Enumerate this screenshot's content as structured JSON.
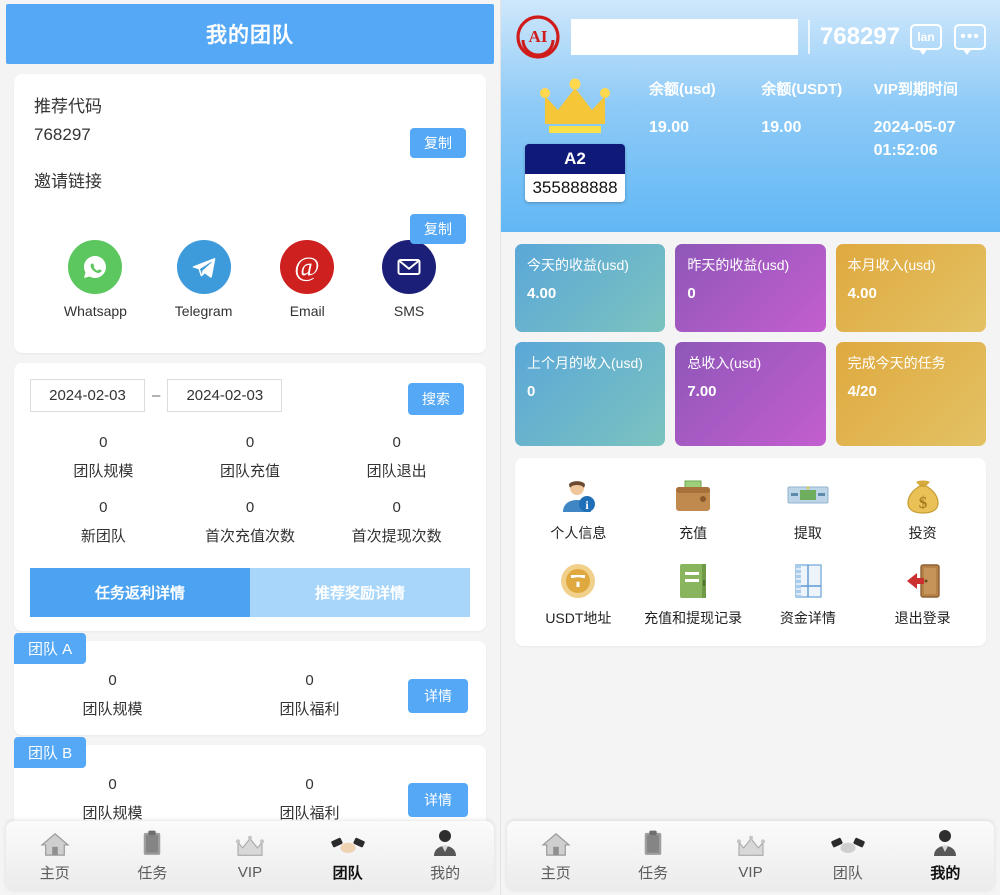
{
  "left": {
    "header": {
      "title": "我的团队"
    },
    "referral": {
      "code_label": "推荐代码",
      "code_value": "768297",
      "link_label": "邀请链接",
      "link_value": "",
      "copy_label_1": "复制",
      "copy_label_2": "复制"
    },
    "share": [
      {
        "name": "whatsapp-icon",
        "label": "Whatsapp"
      },
      {
        "name": "telegram-icon",
        "label": "Telegram"
      },
      {
        "name": "email-icon",
        "label": "Email"
      },
      {
        "name": "sms-icon",
        "label": "SMS"
      }
    ],
    "search": {
      "date_from": "2024-02-03",
      "date_to": "2024-02-03",
      "separator": "–",
      "button_label": "搜索"
    },
    "stats_row1": [
      {
        "value": "0",
        "label": "团队规模"
      },
      {
        "value": "0",
        "label": "团队充值"
      },
      {
        "value": "0",
        "label": "团队退出"
      }
    ],
    "stats_row2": [
      {
        "value": "0",
        "label": "新团队"
      },
      {
        "value": "0",
        "label": "首次充值次数"
      },
      {
        "value": "0",
        "label": "首次提现次数"
      }
    ],
    "tabs": [
      {
        "label": "任务返利详情",
        "active": true
      },
      {
        "label": "推荐奖励详情",
        "active": false
      }
    ],
    "teams": [
      {
        "tag": "团队 A",
        "stats": [
          {
            "value": "0",
            "label": "团队规模"
          },
          {
            "value": "0",
            "label": "团队福利"
          }
        ],
        "detail_label": "详情"
      },
      {
        "tag": "团队 B",
        "stats": [
          {
            "value": "0",
            "label": "团队规模"
          },
          {
            "value": "0",
            "label": "团队福利"
          }
        ],
        "detail_label": "详情"
      }
    ]
  },
  "right": {
    "header": {
      "logo_text": "AI",
      "search_value": "",
      "search_placeholder": "",
      "uid": "768297",
      "lang_icon_text": "lan",
      "chat_icon_text": "•••"
    },
    "hero": {
      "vip_level": "A2",
      "vip_number": "355888888",
      "balances": [
        {
          "label": "余额(usd)",
          "value": "19.00"
        },
        {
          "label": "余额(USDT)",
          "value": "19.00"
        },
        {
          "label": "VIP到期时间",
          "value": "2024-05-07 01:52:06"
        }
      ]
    },
    "stat_cards": [
      {
        "label": "今天的收益(usd)",
        "value": "4.00",
        "color": "#5aa7d8"
      },
      {
        "label": "昨天的收益(usd)",
        "value": "0",
        "color": "#8e57b8"
      },
      {
        "label": "本月收入(usd)",
        "value": "4.00",
        "color": "#dfa93f"
      },
      {
        "label": "上个月的收入(usd)",
        "value": "0",
        "color": "#5aa7d8"
      },
      {
        "label": "总收入(usd)",
        "value": "7.00",
        "color": "#8e57b8"
      },
      {
        "label": "完成今天的任务",
        "value": "4/20",
        "color": "#dfa93f"
      }
    ],
    "menu_row1": [
      {
        "icon": "person-info-icon",
        "label": "个人信息"
      },
      {
        "icon": "wallet-icon",
        "label": "充值"
      },
      {
        "icon": "banknote-icon",
        "label": "提取"
      },
      {
        "icon": "money-bag-icon",
        "label": "投资"
      }
    ],
    "menu_row2": [
      {
        "icon": "usdt-coin-icon",
        "label": "USDT地址"
      },
      {
        "icon": "ledger-book-icon",
        "label": "充值和提现记录"
      },
      {
        "icon": "notebook-icon",
        "label": "资金详情"
      },
      {
        "icon": "logout-door-icon",
        "label": "退出登录"
      }
    ]
  },
  "bottom_nav_left": [
    {
      "icon": "home-icon",
      "label": "主页",
      "active": false
    },
    {
      "icon": "clipboard-icon",
      "label": "任务",
      "active": false
    },
    {
      "icon": "crown-icon",
      "label": "VIP",
      "active": false
    },
    {
      "icon": "handshake-icon",
      "label": "团队",
      "active": true
    },
    {
      "icon": "user-icon",
      "label": "我的",
      "active": false
    }
  ],
  "bottom_nav_right": [
    {
      "icon": "home-icon",
      "label": "主页",
      "active": false
    },
    {
      "icon": "clipboard-icon",
      "label": "任务",
      "active": false
    },
    {
      "icon": "crown-icon",
      "label": "VIP",
      "active": false
    },
    {
      "icon": "handshake-icon",
      "label": "团队",
      "active": false
    },
    {
      "icon": "user-icon",
      "label": "我的",
      "active": true
    }
  ],
  "colors": {
    "accent_blue": "#54a8f5",
    "tab_inactive": "#a8d6fa",
    "vip_navy": "#0f1a78",
    "page_bg": "#f4f4f4"
  }
}
